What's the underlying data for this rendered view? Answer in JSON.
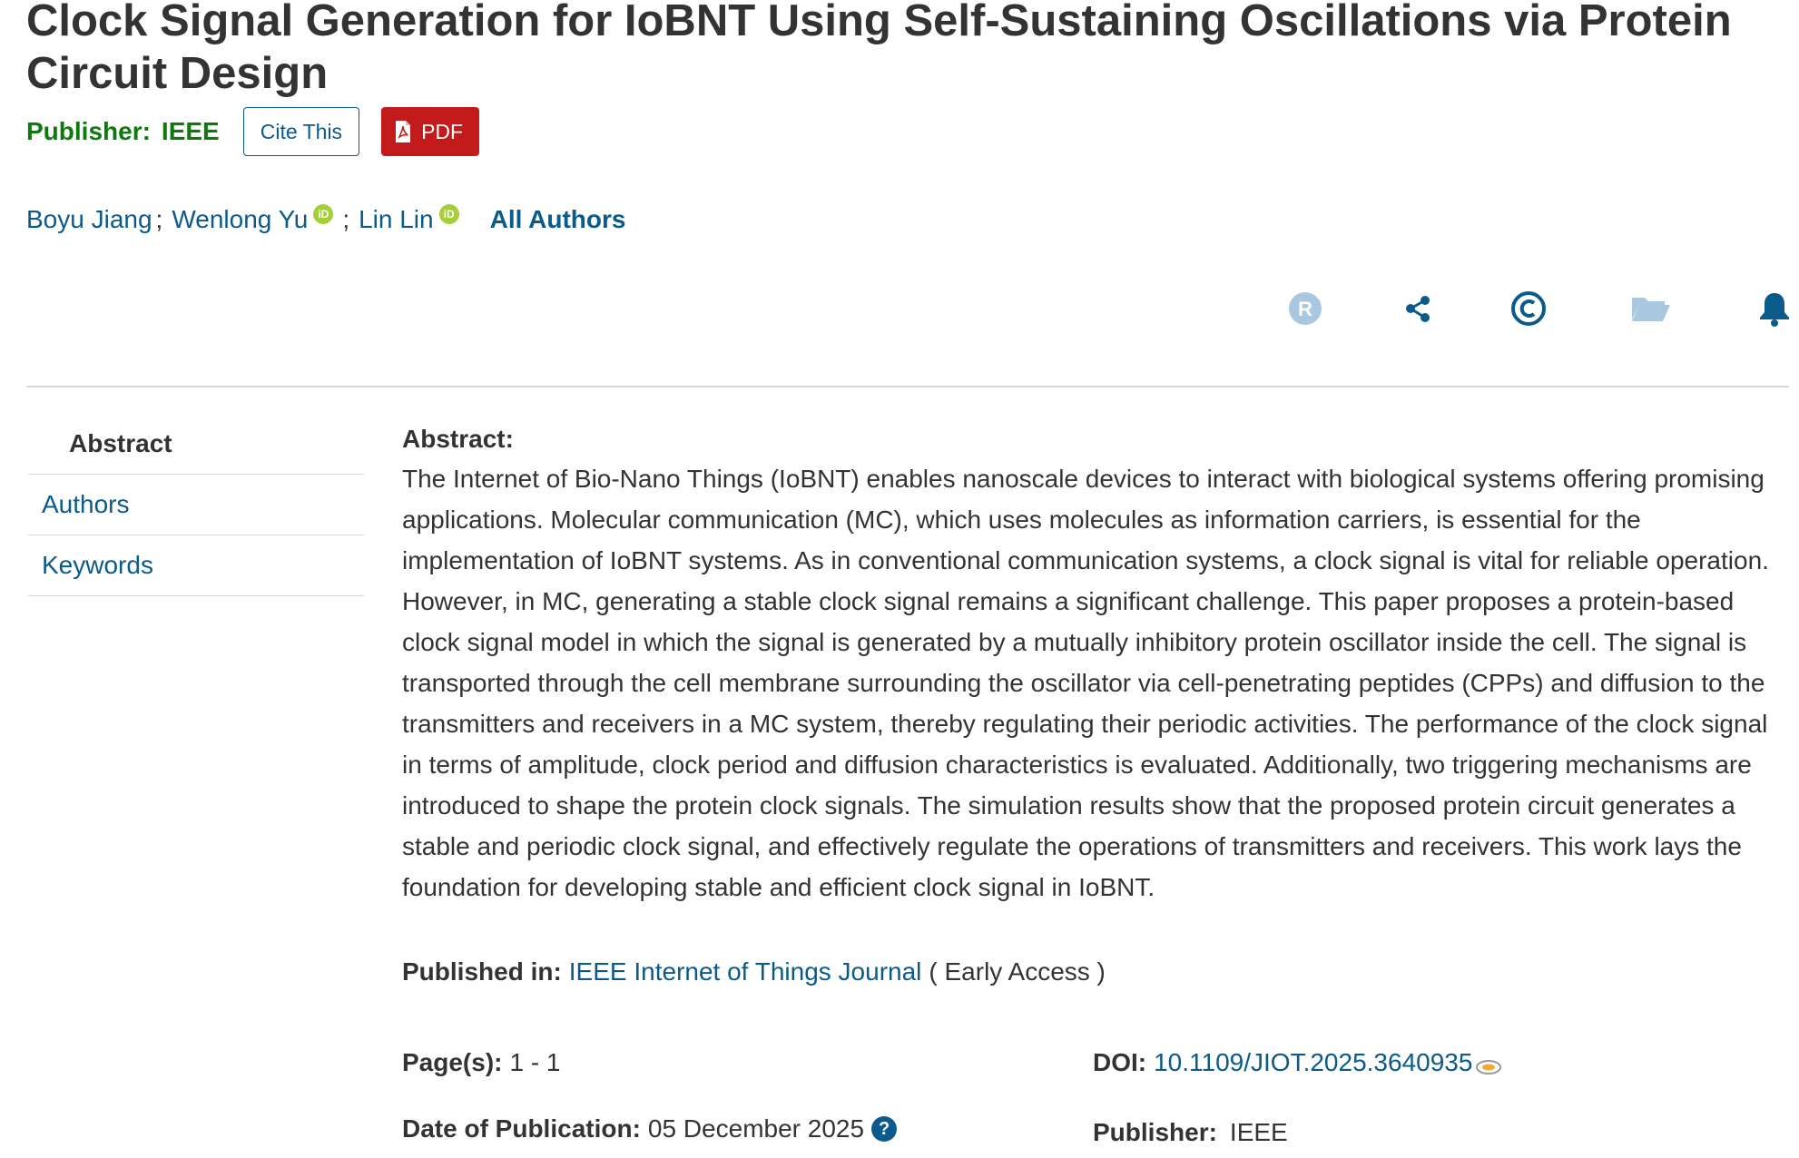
{
  "title": "Clock Signal Generation for IoBNT Using Self-Sustaining Oscillations via Protein Circuit Design",
  "publisher_line": {
    "label": "Publisher:",
    "value": "IEEE"
  },
  "buttons": {
    "cite": "Cite This",
    "pdf": "PDF"
  },
  "authors": [
    {
      "name": "Boyu Jiang",
      "orcid": false,
      "sep": ";"
    },
    {
      "name": "Wenlong Yu",
      "orcid": true,
      "sep": ";"
    },
    {
      "name": "Lin Lin",
      "orcid": true,
      "sep": ""
    }
  ],
  "all_authors": "All Authors",
  "orcid_badge": "iD",
  "toolbar_icons": [
    "rights-icon",
    "share-icon",
    "copyright-icon",
    "folder-icon",
    "bell-icon"
  ],
  "side_nav": {
    "abstract": "Abstract",
    "authors": "Authors",
    "keywords": "Keywords"
  },
  "abstract": {
    "heading": "Abstract:",
    "text": "The Internet of Bio-Nano Things (IoBNT) enables nanoscale devices to interact with biological systems offering promising applications. Molecular communication (MC), which uses molecules as information carriers, is essential for the implementation of IoBNT systems. As in conventional communication systems, a clock signal is vital for reliable operation. However, in MC, generating a stable clock signal remains a significant challenge. This paper proposes a protein-based clock signal model in which the signal is generated by a mutually inhibitory protein oscillator inside the cell. The signal is transported through the cell membrane surrounding the oscillator via cell-penetrating peptides (CPPs) and diffusion to the transmitters and receivers in a MC system, thereby regulating their periodic activities. The performance of the clock signal in terms of amplitude, clock period and diffusion characteristics is evaluated. Additionally, two triggering mechanisms are introduced to shape the protein clock signals. The simulation results show that the proposed protein circuit generates a stable and periodic clock signal, and effectively regulate the operations of transmitters and receivers. This work lays the foundation for developing stable and efficient clock signal in IoBNT."
  },
  "published_in": {
    "label": "Published in:",
    "journal": "IEEE Internet of Things Journal",
    "status": "( Early Access )"
  },
  "pages": {
    "label": "Page(s):",
    "value": "1 - 1"
  },
  "doi": {
    "label": "DOI:",
    "value": "10.1109/JIOT.2025.3640935"
  },
  "date": {
    "label": "Date of Publication:",
    "value": "05 December 2025",
    "help": "?"
  },
  "publisher_meta": {
    "label": "Publisher:",
    "value": "IEEE"
  },
  "colors": {
    "link": "#0b5a8c",
    "publisher_green": "#0e7a0d",
    "pdf_red": "#c31b1b",
    "icon_blue": "#0b5a8c",
    "icon_light": "#a9c7df",
    "orcid_green": "#a6ce39"
  }
}
